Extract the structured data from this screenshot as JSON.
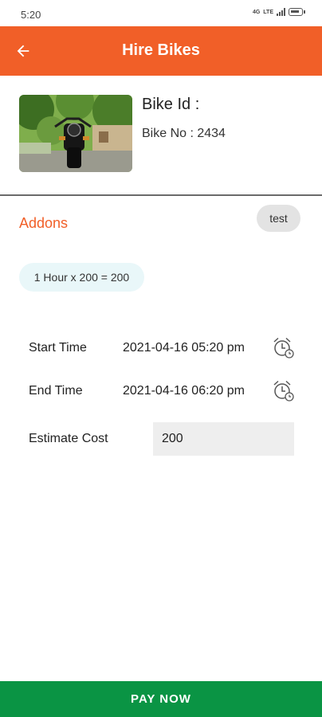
{
  "status_bar": {
    "time": "5:20",
    "net_label": "4G",
    "network_type": "LTE",
    "icons": [
      "lte-icon",
      "signal-icon",
      "battery-icon"
    ]
  },
  "app_bar": {
    "title": "Hire Bikes",
    "back_icon": "arrow-left-icon",
    "color": "#f15f28"
  },
  "bike": {
    "id_label": "Bike Id :",
    "number_label": "Bike No : 2434",
    "photo": "motorcycle-photo"
  },
  "addons": {
    "label": "Addons",
    "chip": "test",
    "rate": "1 Hour x 200 = 200"
  },
  "booking": {
    "start_label": "Start Time",
    "start_value": "2021-04-16 05:20 pm",
    "end_label": "End Time",
    "end_value": "2021-04-16 06:20 pm",
    "cost_label": "Estimate Cost",
    "cost_value": "200",
    "time_icon": "alarm-clock-icon"
  },
  "pay": {
    "label": "PAY NOW",
    "color": "#0a9444"
  }
}
